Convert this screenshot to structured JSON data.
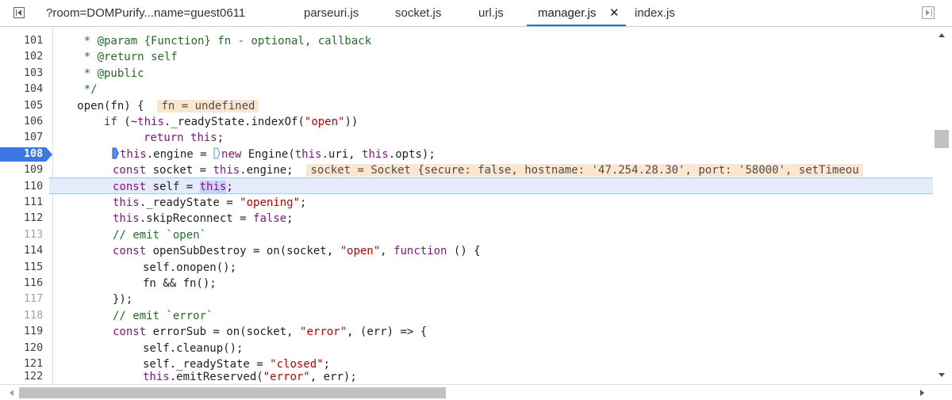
{
  "tabs": [
    {
      "label": "?room=DOMPurify...name=guest0611",
      "active": false
    },
    {
      "label": "parseuri.js",
      "active": false
    },
    {
      "label": "socket.js",
      "active": false
    },
    {
      "label": "url.js",
      "active": false
    },
    {
      "label": "manager.js",
      "active": true,
      "close": "✕"
    },
    {
      "label": "index.js",
      "active": false
    }
  ],
  "editor": {
    "current_line": "108",
    "highlighted_line": "110",
    "lines": [
      {
        "n": "101",
        "dim": false
      },
      {
        "n": "102",
        "dim": false
      },
      {
        "n": "103",
        "dim": false
      },
      {
        "n": "104",
        "dim": false
      },
      {
        "n": "105",
        "dim": false
      },
      {
        "n": "106",
        "dim": false
      },
      {
        "n": "107",
        "dim": false
      },
      {
        "n": "108",
        "dim": false
      },
      {
        "n": "109",
        "dim": false
      },
      {
        "n": "110",
        "dim": false
      },
      {
        "n": "111",
        "dim": false
      },
      {
        "n": "112",
        "dim": false
      },
      {
        "n": "113",
        "dim": true
      },
      {
        "n": "114",
        "dim": false
      },
      {
        "n": "115",
        "dim": false
      },
      {
        "n": "116",
        "dim": false
      },
      {
        "n": "117",
        "dim": true
      },
      {
        "n": "118",
        "dim": true
      },
      {
        "n": "119",
        "dim": false
      },
      {
        "n": "120",
        "dim": false
      },
      {
        "n": "121",
        "dim": false
      },
      {
        "n": "122",
        "dim": false
      }
    ],
    "code": {
      "l101": "    * @param {Function} fn - optional, callback",
      "l102": "    * @return self",
      "l103": "    * @public",
      "l104": "    */",
      "l105_a": "   open(fn) {  ",
      "l105_val": "fn = undefined",
      "l106_a": "       if (~",
      "l106_this": "this",
      "l106_b": "._readyState.indexOf(",
      "l106_str": "\"open\"",
      "l106_c": "))",
      "l107_kw": "return",
      "l107_this": "this",
      "l107_c": ";",
      "l108_this": "this",
      "l108_a": ".engine = ",
      "l108_kw": "new",
      "l108_b": " Engine(",
      "l108_this2": "this",
      "l108_c": ".uri, ",
      "l108_this3": "this",
      "l108_d": ".opts);",
      "l109_kw": "const",
      "l109_a": " socket = ",
      "l109_this": "this",
      "l109_b": ".engine;  ",
      "l109_val": "socket = Socket {secure: false, hostname: '47.254.28.30', port: '58000', setTimeou",
      "l110_kw": "const",
      "l110_a": " self = ",
      "l110_this": "this",
      "l110_b": ";",
      "l111_this": "this",
      "l111_a": "._readyState = ",
      "l111_str": "\"opening\"",
      "l111_b": ";",
      "l112_this": "this",
      "l112_a": ".skipReconnect = ",
      "l112_kw": "false",
      "l112_b": ";",
      "l113": "// emit `open`",
      "l114_kw": "const",
      "l114_a": " openSubDestroy = on(socket, ",
      "l114_str": "\"open\"",
      "l114_b": ", ",
      "l114_kw2": "function",
      "l114_c": " () {",
      "l115": "self.onopen();",
      "l116": "fn && fn();",
      "l117": "});",
      "l118": "// emit `error`",
      "l119_kw": "const",
      "l119_a": " errorSub = on(socket, ",
      "l119_str": "\"error\"",
      "l119_b": ", (err) => {",
      "l120": "self.cleanup();",
      "l121_a": "self._readyState = ",
      "l121_str": "\"closed\"",
      "l121_b": ";",
      "l122_this": "this",
      "l122_a": ".emitReserved(",
      "l122_str": "\"error\"",
      "l122_b": ", err);"
    }
  },
  "edge_chars": [
    "3",
    ":",
    "r",
    ":",
    "e",
    "r"
  ],
  "colors": {
    "accent": "#1a73e8",
    "breakpoint": "#3b78e7",
    "keyword": "#881391",
    "string": "#c80000",
    "comment": "#236e25",
    "inline_value_bg": "#fde6cf",
    "highlight_bg": "#e5ebfb"
  },
  "icons": {
    "toggle_navigator": "sidebar-left-icon",
    "toggle_debugger": "sidebar-right-icon",
    "step_marker": "continue-marker-icon"
  }
}
